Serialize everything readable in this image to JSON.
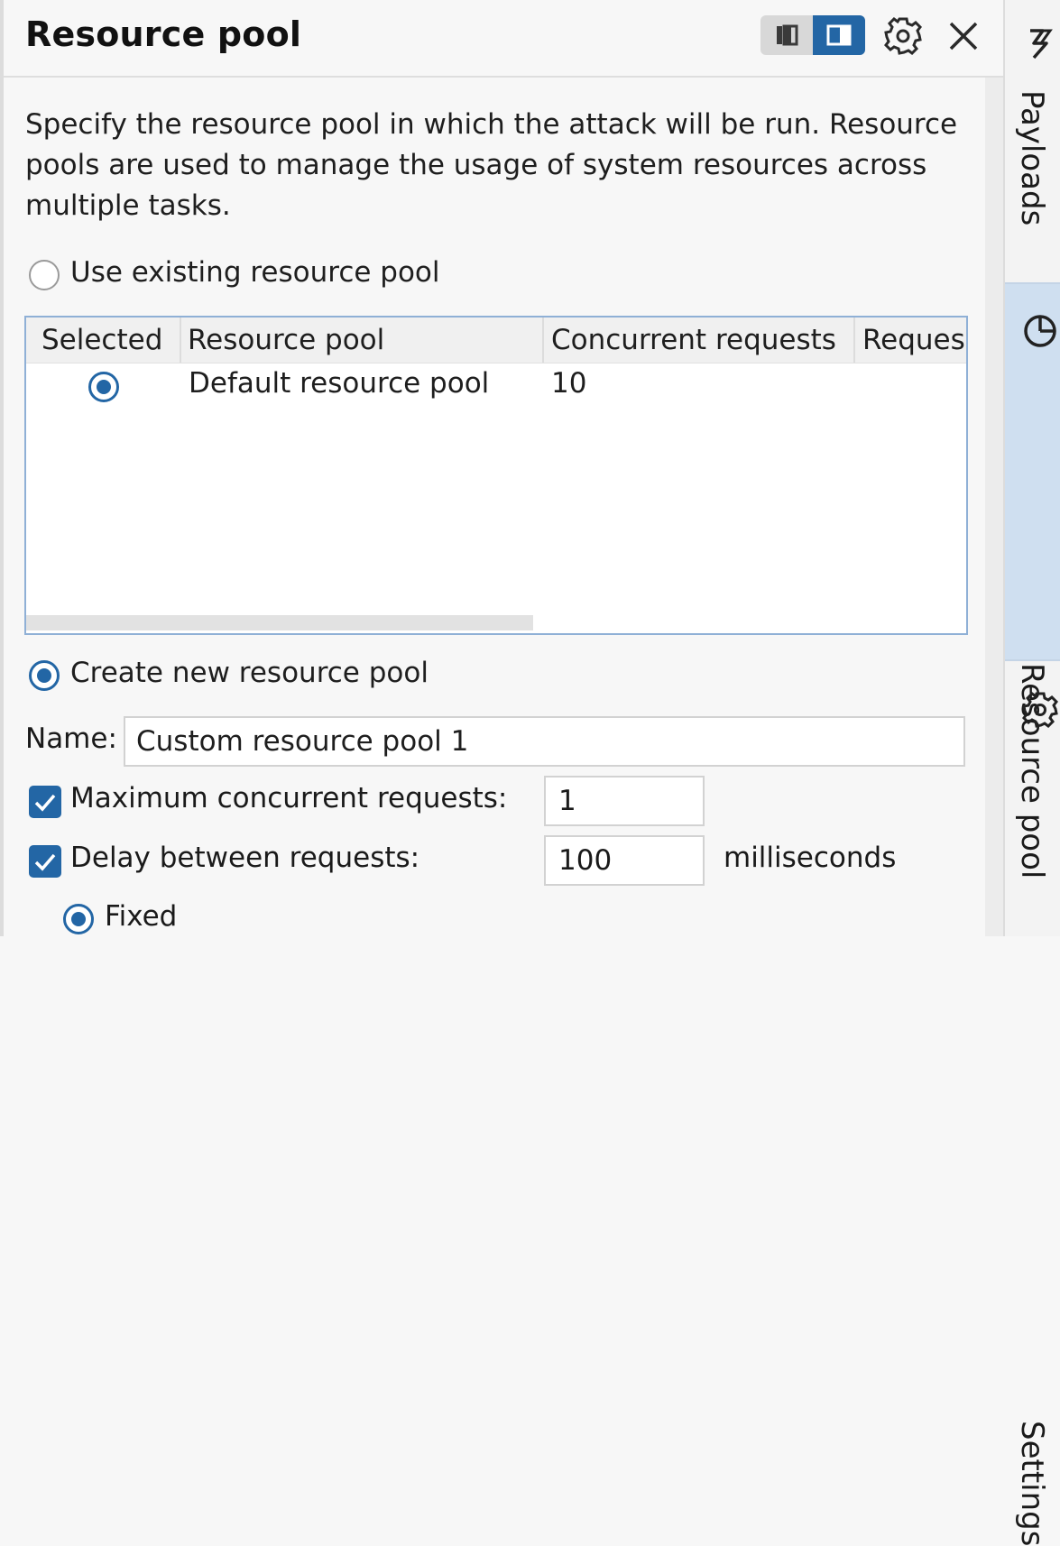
{
  "panel": {
    "title": "Resource pool",
    "description": "Specify the resource pool in which the attack will be run. Resource pools are used to manage the usage of system resources across multiple tasks.",
    "accent_color": "#2366a5"
  },
  "header_controls": {
    "layout_toggle": {
      "options": [
        "sidebar-layout-icon",
        "panel-layout-icon"
      ],
      "selected": "panel-layout-icon"
    },
    "settings_icon": "gear-icon",
    "close_icon": "close-icon"
  },
  "existing_pool": {
    "label": "Use existing resource pool",
    "selected": false,
    "table": {
      "columns": [
        "Selected",
        "Resource pool",
        "Concurrent requests",
        "Reques"
      ],
      "rows": [
        {
          "selected": true,
          "resource_pool": "Default resource pool",
          "concurrent_requests": "10",
          "requests": ""
        }
      ]
    }
  },
  "new_pool": {
    "label": "Create new resource pool",
    "selected": true,
    "name_label": "Name:",
    "name_value": "Custom resource pool 1",
    "max_concurrent": {
      "label": "Maximum concurrent requests:",
      "checked": true,
      "value": "1"
    },
    "delay": {
      "label": "Delay between requests:",
      "checked": true,
      "value": "100",
      "unit": "milliseconds"
    },
    "delay_mode": {
      "label": "Fixed",
      "selected": true
    }
  },
  "side_tabs": [
    {
      "label": "Payloads",
      "icon": "payloads-icon",
      "active": false
    },
    {
      "label": "Resource pool",
      "icon": "resource-pool-icon",
      "active": true
    },
    {
      "label": "Settings",
      "icon": "gear-icon",
      "active": false
    }
  ]
}
